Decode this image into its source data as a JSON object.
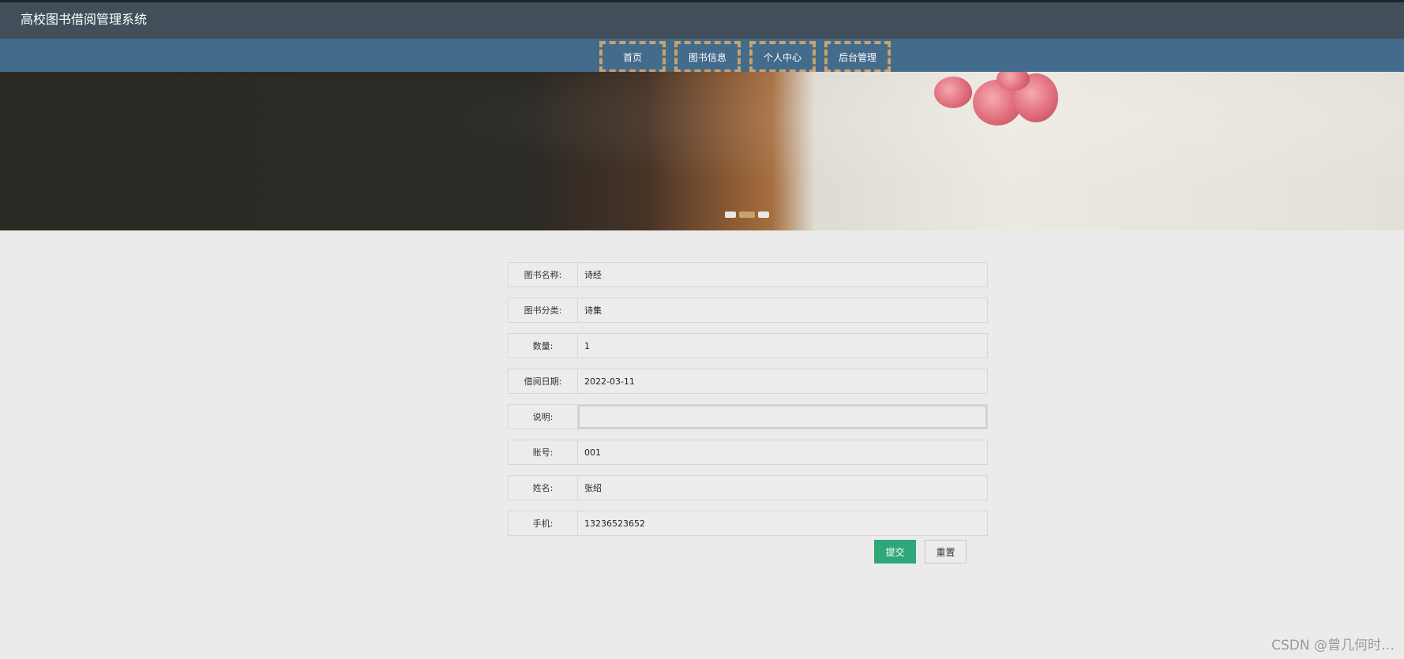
{
  "app": {
    "title": "高校图书借阅管理系统"
  },
  "nav": {
    "items": [
      {
        "label": "首页"
      },
      {
        "label": "图书信息"
      },
      {
        "label": "个人中心"
      },
      {
        "label": "后台管理"
      }
    ]
  },
  "banner": {
    "slide_count": 3,
    "active_slide": 2
  },
  "form": {
    "fields": [
      {
        "label": "图书名称:",
        "value": "诗经"
      },
      {
        "label": "图书分类:",
        "value": "诗集"
      },
      {
        "label": "数量:",
        "value": "1"
      },
      {
        "label": "借阅日期:",
        "value": "2022-03-11"
      },
      {
        "label": "说明:",
        "value": ""
      },
      {
        "label": "账号:",
        "value": "001"
      },
      {
        "label": "姓名:",
        "value": "张绍"
      },
      {
        "label": "手机:",
        "value": "13236523652"
      }
    ],
    "submit_label": "提交",
    "reset_label": "重置"
  },
  "watermark": "CSDN @曾几何时…",
  "colors": {
    "title_bar": "#424f5b",
    "nav_bar": "#436b8c",
    "nav_border": "#c8a26b",
    "submit": "#2fa779",
    "page_bg": "#ebebeb"
  }
}
